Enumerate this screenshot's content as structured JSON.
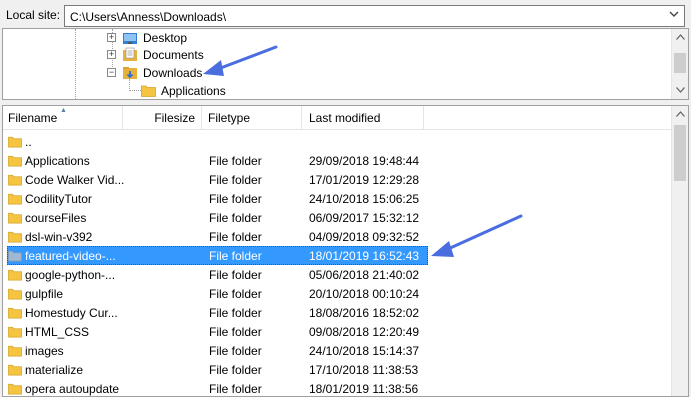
{
  "site_bar": {
    "label": "Local site:",
    "path": "C:\\Users\\Anness\\Downloads\\"
  },
  "tree": {
    "items": [
      {
        "label": "Desktop",
        "expander": "+",
        "icon": "folder-blue-icon"
      },
      {
        "label": "Documents",
        "expander": "+",
        "icon": "documents-folder-icon"
      },
      {
        "label": "Downloads",
        "expander": "−",
        "icon": "downloads-folder-icon"
      },
      {
        "label": "Applications",
        "icon": "folder-icon"
      }
    ]
  },
  "list": {
    "columns": [
      "Filename",
      "Filesize",
      "Filetype",
      "Last modified"
    ],
    "parent_entry": "..",
    "rows": [
      {
        "name": "Applications",
        "type": "File folder",
        "modified": "29/09/2018 19:48:44"
      },
      {
        "name": "Code Walker Vid...",
        "type": "File folder",
        "modified": "17/01/2019 12:29:28"
      },
      {
        "name": "CodilityTutor",
        "type": "File folder",
        "modified": "24/10/2018 15:06:25"
      },
      {
        "name": "courseFiles",
        "type": "File folder",
        "modified": "06/09/2017 15:32:12"
      },
      {
        "name": "dsl-win-v392",
        "type": "File folder",
        "modified": "04/09/2018 09:32:52"
      },
      {
        "name": "featured-video-...",
        "type": "File folder",
        "modified": "18/01/2019 16:52:43",
        "selected": true
      },
      {
        "name": "google-python-...",
        "type": "File folder",
        "modified": "05/06/2018 21:40:02"
      },
      {
        "name": "gulpfile",
        "type": "File folder",
        "modified": "20/10/2018 00:10:24"
      },
      {
        "name": "Homestudy Cur...",
        "type": "File folder",
        "modified": "18/08/2016 18:52:02"
      },
      {
        "name": "HTML_CSS",
        "type": "File folder",
        "modified": "09/08/2018 12:20:49"
      },
      {
        "name": "images",
        "type": "File folder",
        "modified": "24/10/2018 15:14:37"
      },
      {
        "name": "materialize",
        "type": "File folder",
        "modified": "17/10/2018 11:38:53"
      },
      {
        "name": "opera autoupdate",
        "type": "File folder",
        "modified": "18/01/2019 11:38:56"
      }
    ]
  },
  "colors": {
    "selection": "#3399ff",
    "folder": "#f5c542",
    "annotation_arrow": "#4a6ee0"
  },
  "icons": {
    "combo_arrow": "chevron-down-icon",
    "scroll_up": "scroll-up-icon",
    "scroll_down": "scroll-down-icon"
  }
}
